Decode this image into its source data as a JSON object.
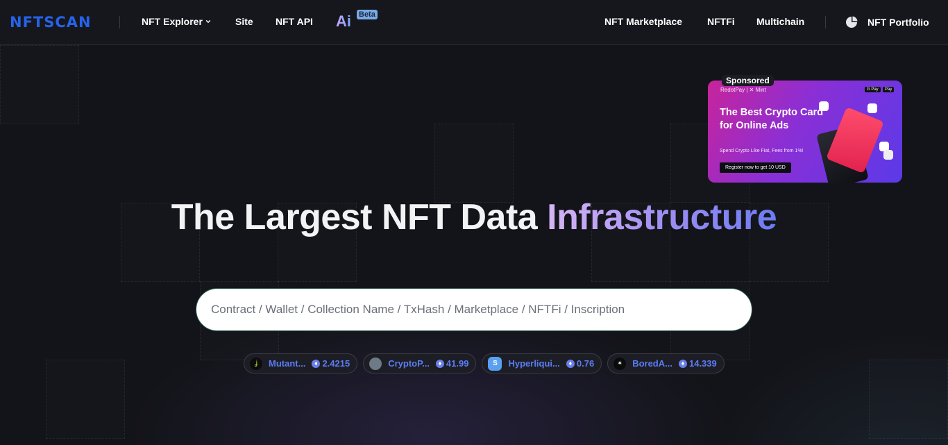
{
  "brand": {
    "logo_text": "NFTSCAN",
    "accent": "#2563eb"
  },
  "nav": {
    "explorer_label": "NFT Explorer",
    "site_label": "Site",
    "api_label": "NFT API",
    "ai_label": "Ai",
    "beta_label": "Beta",
    "marketplace_label": "NFT Marketplace",
    "nftfi_label": "NFTFi",
    "multichain_label": "Multichain",
    "portfolio_label": "NFT Portfolio",
    "explorer_icon": "chevron-down-icon",
    "portfolio_icon": "pie-chart-icon"
  },
  "ad": {
    "badge": "Sponsored",
    "brand": "RedotPay | ✕ Mint",
    "pay1": "G Pay",
    "pay2": " Pay",
    "title": "The Best Crypto Card for Online Ads",
    "subtitle": "Spend Crypto Like Fiat, Fees from 1%!",
    "button": "Register now to get 10 USD"
  },
  "hero": {
    "title_part1": "The Largest NFT Data ",
    "title_part2": "Infrastructure"
  },
  "search": {
    "placeholder": "Contract / Wallet / Collection Name / TxHash / Marketplace / NFTFi / Inscription",
    "value": ""
  },
  "trending": [
    {
      "name": "Mutant...",
      "value": "2.4215",
      "icon": "mutant-ape-avatar-icon"
    },
    {
      "name": "CryptoP...",
      "value": "41.99",
      "icon": "cryptopunk-avatar-icon"
    },
    {
      "name": "Hyperliqui...",
      "value": "0.76",
      "icon": "hyperliquid-avatar-icon"
    },
    {
      "name": "BoredA...",
      "value": "14.339",
      "icon": "bored-ape-avatar-icon"
    }
  ]
}
